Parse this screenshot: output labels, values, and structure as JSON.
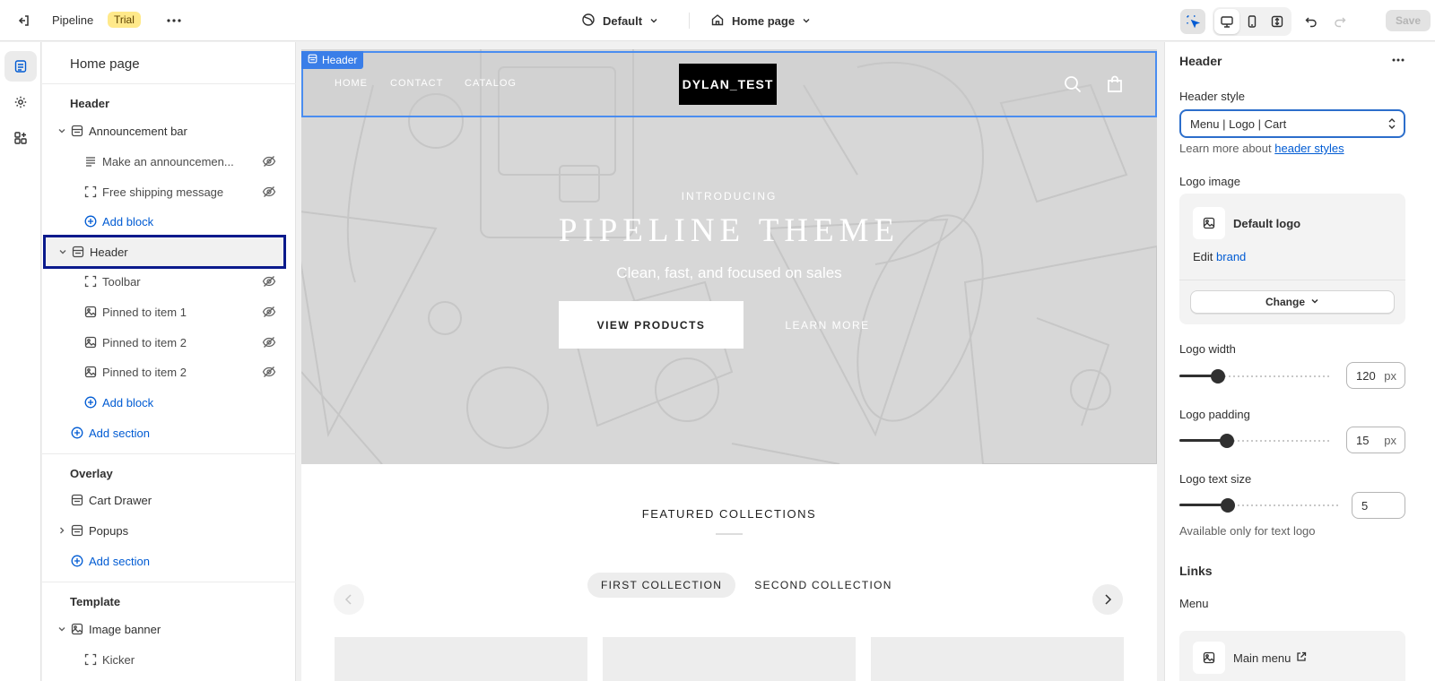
{
  "topbar": {
    "app_name": "Pipeline",
    "badge": "Trial",
    "theme": "Default",
    "page": "Home page",
    "save": "Save"
  },
  "sidebar": {
    "title": "Home page",
    "groups": {
      "header": "Header",
      "overlay": "Overlay",
      "template": "Template"
    },
    "items": {
      "announcement_bar": "Announcement bar",
      "make_announcement": "Make an announcemen...",
      "free_shipping": "Free shipping message",
      "add_block_1": "Add block",
      "header": "Header",
      "toolbar": "Toolbar",
      "pinned_1": "Pinned to item 1",
      "pinned_2": "Pinned to item 2",
      "pinned_3": "Pinned to item 2",
      "add_block_2": "Add block",
      "add_section_1": "Add section",
      "cart_drawer": "Cart Drawer",
      "popups": "Popups",
      "add_section_2": "Add section",
      "image_banner": "Image banner",
      "kicker": "Kicker"
    }
  },
  "preview": {
    "header_tag": "Header",
    "nav": [
      "HOME",
      "CONTACT",
      "CATALOG"
    ],
    "logo": "DYLAN_TEST",
    "intro": "INTRODUCING",
    "hero_title": "PIPELINE THEME",
    "hero_sub": "Clean, fast, and focused on sales",
    "btn_view": "VIEW PRODUCTS",
    "btn_learn": "LEARN MORE",
    "featured": "FEATURED COLLECTIONS",
    "tabs": [
      "FIRST COLLECTION",
      "SECOND COLLECTION"
    ]
  },
  "panel": {
    "title": "Header",
    "header_style_label": "Header style",
    "header_style_value": "Menu | Logo | Cart",
    "learn_more_prefix": "Learn more about",
    "learn_more_link": "header styles",
    "logo_image_label": "Logo image",
    "logo_name": "Default logo",
    "edit_prefix": "Edit",
    "edit_link": "brand",
    "change": "Change",
    "logo_width_label": "Logo width",
    "logo_width_value": "120",
    "logo_width_fraction": 0.25,
    "logo_padding_label": "Logo padding",
    "logo_padding_value": "15",
    "logo_padding_fraction": 0.31,
    "logo_text_size_label": "Logo text size",
    "logo_text_size_value": "5",
    "logo_text_size_fraction": 0.3,
    "unit": "px",
    "text_logo_help": "Available only for text logo",
    "links_section": "Links",
    "menu_label": "Menu",
    "menu_value": "Main menu"
  },
  "colors": {
    "accent": "#005bd3",
    "selection_outline": "#0a1a8c",
    "preview_outline": "#3a7ee8",
    "trial_badge": "#ffe98a"
  }
}
